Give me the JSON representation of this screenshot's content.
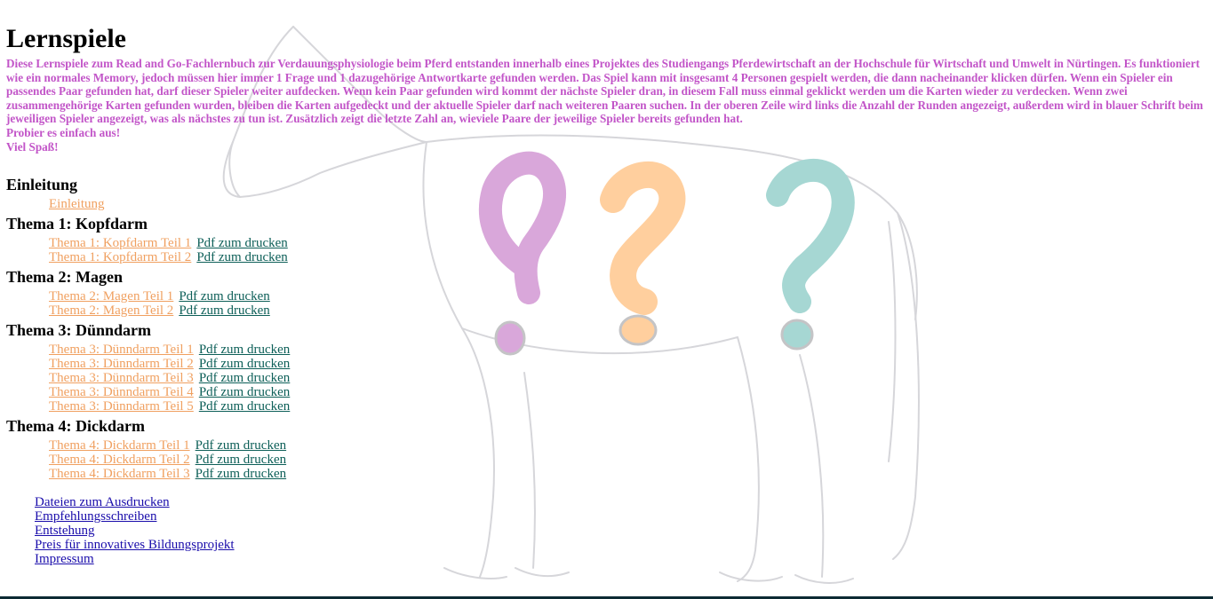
{
  "page": {
    "title": "Lernspiele",
    "intro_paragraphs": [
      "Diese Lernspiele zum Read and Go-Fachlernbuch zur Verdauungsphysiologie beim Pferd entstanden innerhalb eines Projektes des Studiengangs Pferdewirtschaft an der Hochschule für Wirtschaft und Umwelt in Nürtingen. Es funktioniert wie ein normales Memory, jedoch müssen hier immer 1 Frage und 1 dazugehörige Antwortkarte gefunden werden. Das Spiel kann mit insgesamt 4 Personen gespielt werden, die dann nacheinander klicken dürfen. Wenn ein Spieler ein passendes Paar gefunden hat, darf dieser Spieler weiter aufdecken. Wenn kein Paar gefunden wird kommt der nächste Spieler dran, in diesem Fall muss einmal geklickt werden um die Karten wieder zu verdecken. Wenn zwei zusammengehörige Karten gefunden wurden, bleiben die Karten aufgedeckt und der aktuelle Spieler darf nach weiteren Paaren suchen. In der oberen Zeile wird links die Anzahl der Runden angezeigt, außerdem wird in blauer Schrift beim jeweiligen Spieler angezeigt, was als nächstes zu tun ist. Zusätzlich zeigt die letzte Zahl an, wieviele Paare der jeweilige Spieler bereits gefunden hat.",
      "Probier es einfach aus!",
      "Viel Spaß!"
    ]
  },
  "colors": {
    "intro_text": "#c255c8",
    "game_link": "#f0a060",
    "pdf_link": "#0d5f58",
    "footer_link": "#1a0dab",
    "qmark_purple": "#d9a7da",
    "qmark_orange": "#ffcf9e",
    "qmark_teal": "#a6d7d3"
  },
  "background": {
    "image": "horse-sketch-with-question-marks"
  },
  "sections": [
    {
      "heading": "Einleitung",
      "items": [
        {
          "game": "Einleitung"
        }
      ]
    },
    {
      "heading": "Thema 1: Kopfdarm",
      "items": [
        {
          "game": "Thema 1: Kopfdarm Teil 1",
          "pdf": "Pdf zum drucken"
        },
        {
          "game": "Thema 1: Kopfdarm Teil 2",
          "pdf": "Pdf zum drucken"
        }
      ]
    },
    {
      "heading": "Thema 2: Magen",
      "items": [
        {
          "game": "Thema 2: Magen Teil 1",
          "pdf": "Pdf zum drucken"
        },
        {
          "game": "Thema 2: Magen Teil 2",
          "pdf": "Pdf zum drucken"
        }
      ]
    },
    {
      "heading": "Thema 3: Dünndarm",
      "items": [
        {
          "game": "Thema 3: Dünndarm Teil 1",
          "pdf": "Pdf zum drucken"
        },
        {
          "game": "Thema 3: Dünndarm Teil 2",
          "pdf": "Pdf zum drucken"
        },
        {
          "game": "Thema 3: Dünndarm Teil 3",
          "pdf": "Pdf zum drucken"
        },
        {
          "game": "Thema 3: Dünndarm Teil 4",
          "pdf": "Pdf zum drucken"
        },
        {
          "game": "Thema 3: Dünndarm Teil 5",
          "pdf": "Pdf zum drucken"
        }
      ]
    },
    {
      "heading": "Thema 4: Dickdarm",
      "items": [
        {
          "game": "Thema 4: Dickdarm Teil 1",
          "pdf": "Pdf zum drucken"
        },
        {
          "game": "Thema 4: Dickdarm Teil 2",
          "pdf": "Pdf zum drucken"
        },
        {
          "game": "Thema 4: Dickdarm Teil 3",
          "pdf": "Pdf zum drucken"
        }
      ]
    }
  ],
  "footer_links": [
    "Dateien zum Ausdrucken",
    "Empfehlungsschreiben",
    "Entstehung",
    "Preis für innovatives Bildungsprojekt",
    "Impressum"
  ]
}
